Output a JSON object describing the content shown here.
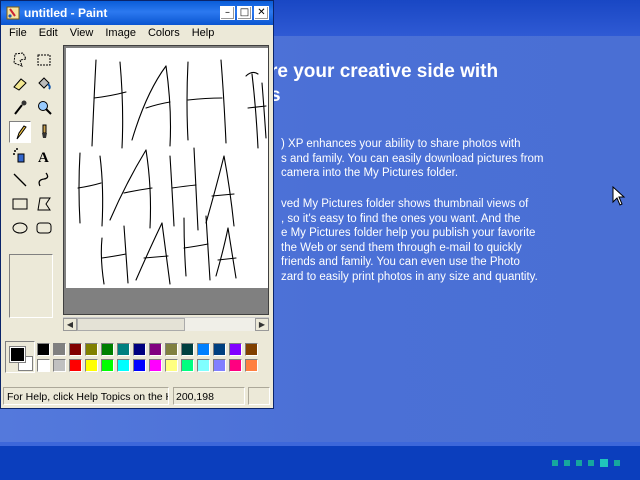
{
  "window": {
    "title": "untitled - Paint",
    "minimize_glyph": "–",
    "maximize_glyph": "□",
    "close_glyph": "✕"
  },
  "menu": [
    "File",
    "Edit",
    "View",
    "Image",
    "Colors",
    "Help"
  ],
  "tools": [
    {
      "name": "free-form-select-icon"
    },
    {
      "name": "select-icon"
    },
    {
      "name": "eraser-icon"
    },
    {
      "name": "fill-bucket-icon"
    },
    {
      "name": "pick-color-icon"
    },
    {
      "name": "magnifier-icon"
    },
    {
      "name": "pencil-icon",
      "selected": true
    },
    {
      "name": "brush-icon"
    },
    {
      "name": "airbrush-icon"
    },
    {
      "name": "text-tool-icon",
      "glyph": "A"
    },
    {
      "name": "line-icon"
    },
    {
      "name": "curve-icon"
    },
    {
      "name": "rectangle-icon"
    },
    {
      "name": "polygon-icon"
    },
    {
      "name": "ellipse-icon"
    },
    {
      "name": "rounded-rectangle-icon"
    }
  ],
  "palette": {
    "foreground": "#000000",
    "background": "#ffffff",
    "row1": [
      "#000000",
      "#808080",
      "#800000",
      "#808000",
      "#008000",
      "#008080",
      "#000080",
      "#800080",
      "#808040",
      "#004040",
      "#0080ff",
      "#004080",
      "#8000ff",
      "#804000"
    ],
    "row2": [
      "#ffffff",
      "#c0c0c0",
      "#ff0000",
      "#ffff00",
      "#00ff00",
      "#00ffff",
      "#0000ff",
      "#ff00ff",
      "#ffff80",
      "#00ff80",
      "#80ffff",
      "#8080ff",
      "#ff0080",
      "#ff8040"
    ]
  },
  "status": {
    "help_text": "For Help, click Help Topics on the Help Menu.",
    "coordinates": "200,198"
  },
  "tour": {
    "heading_line1": "re your creative side with",
    "heading_line2": "s",
    "para1": ") XP enhances your ability to share photos with\ns and family. You can easily download pictures from\ncamera into the My Pictures folder.",
    "para2": "ved My Pictures folder shows thumbnail views of\n, so it's easy to find the ones you want. And the\ne My Pictures folder help you publish your favorite\n the Web or send them through e-mail to quickly\n friends and family. You can even use the Photo\nzard to easily print photos in any size and quantity."
  },
  "colors": {
    "titlebar": "#0a5dd8",
    "desktop_blue": "#4a6fd3",
    "dots": "#16a69e"
  }
}
